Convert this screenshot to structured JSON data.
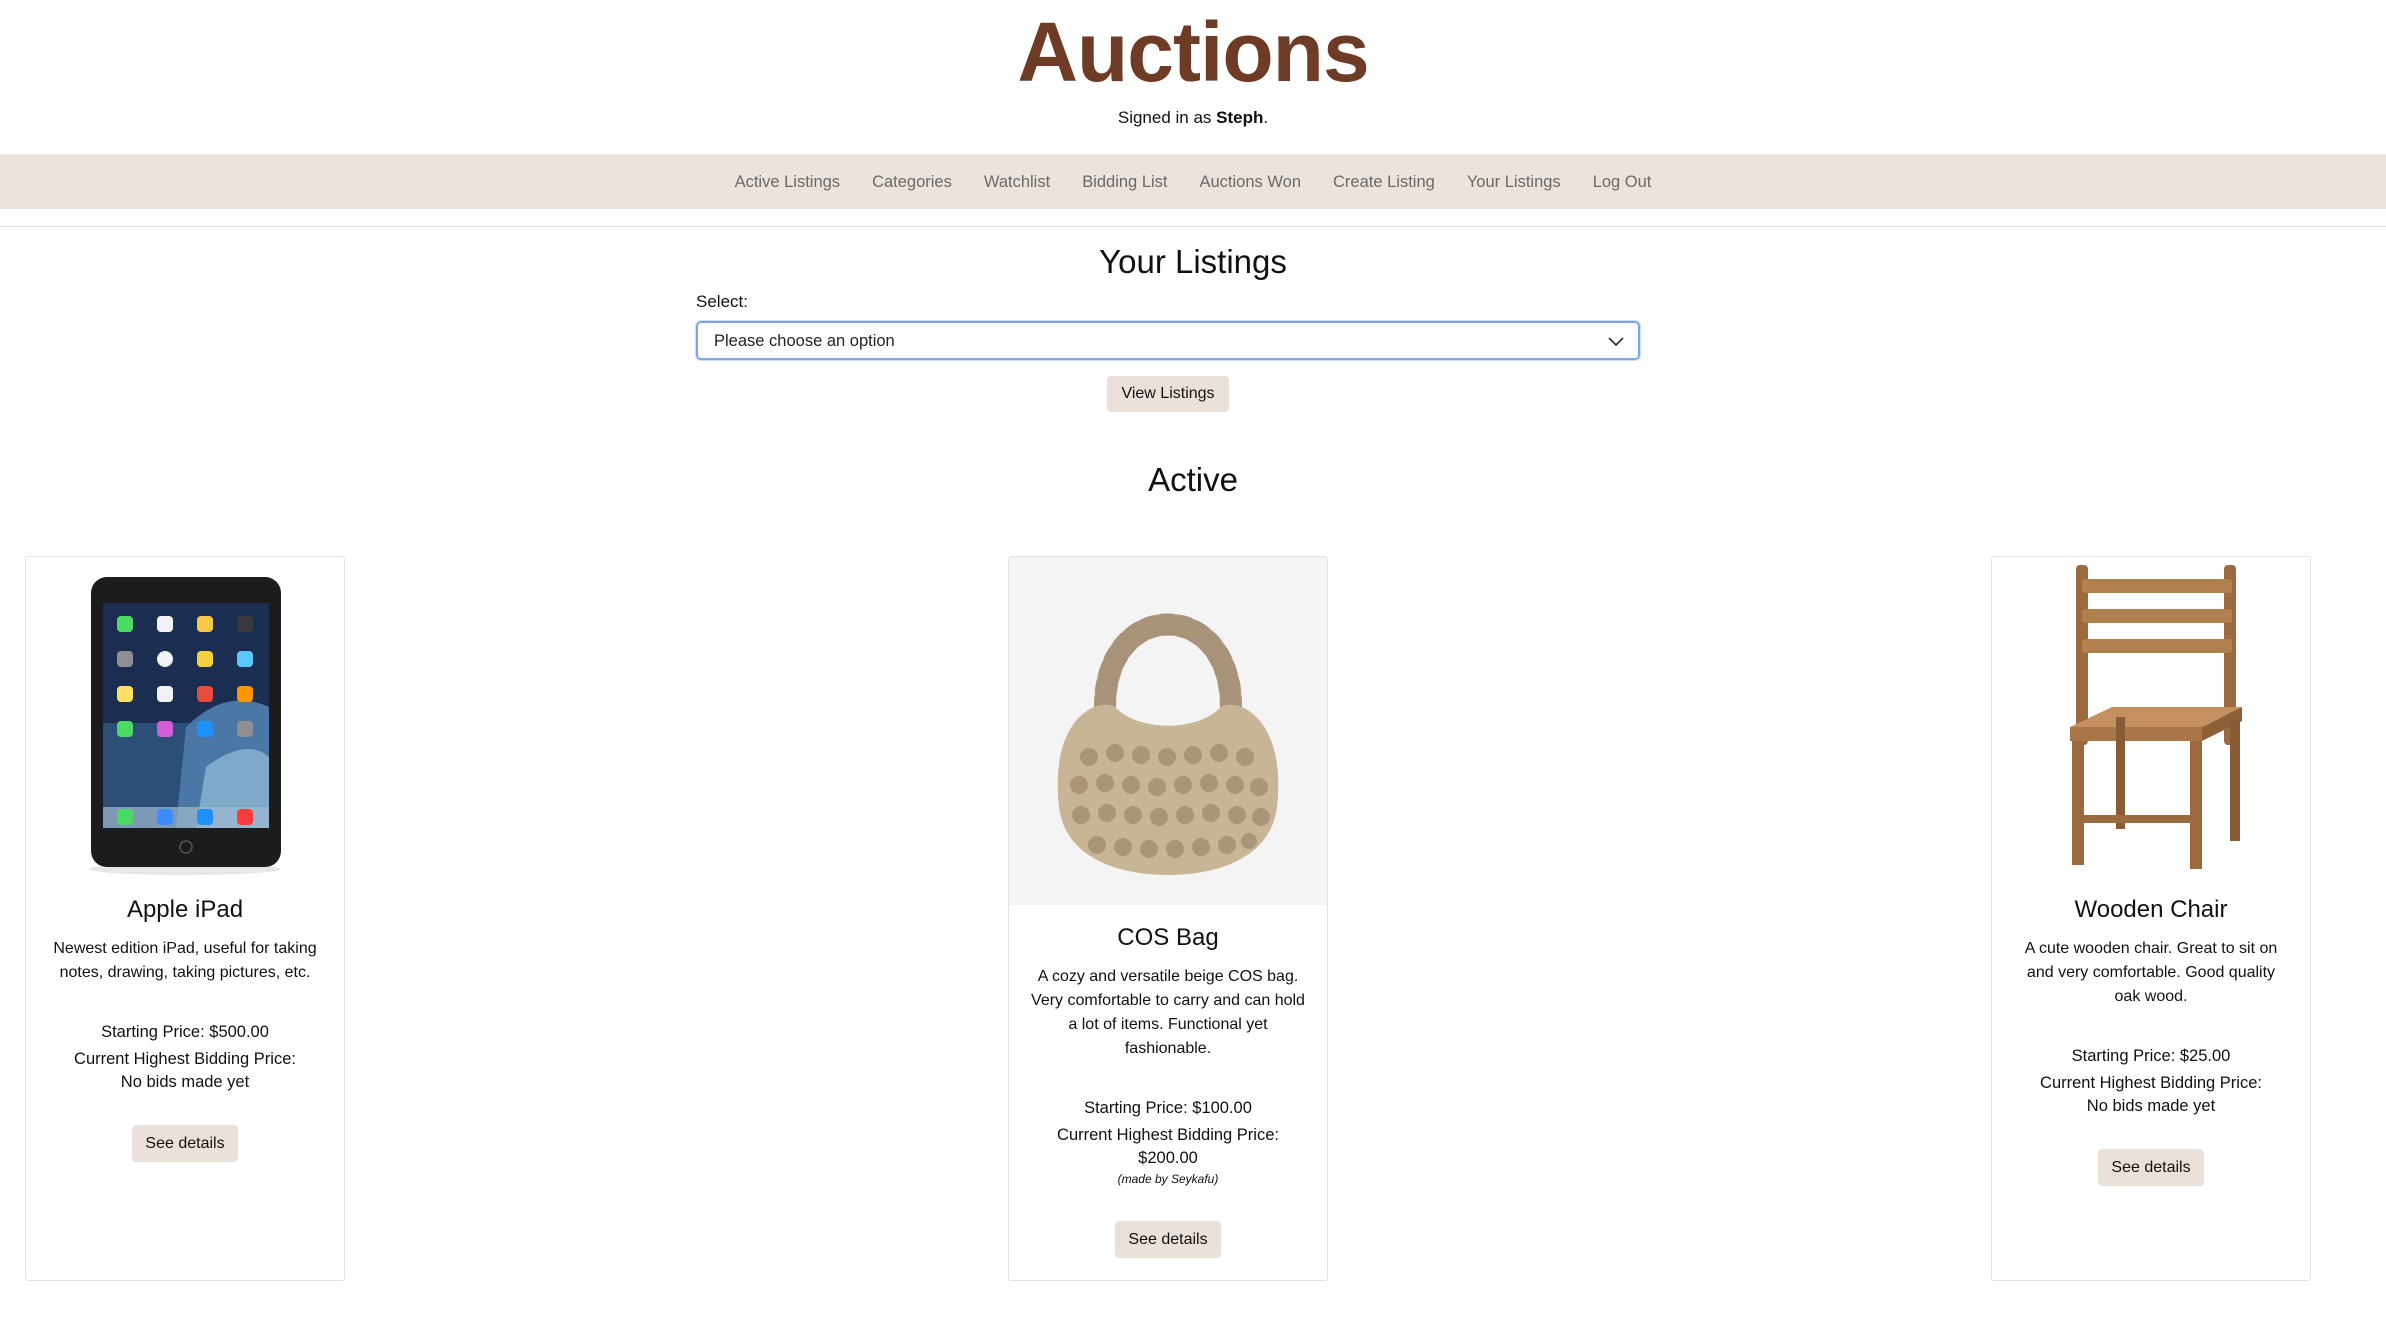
{
  "header": {
    "title": "Auctions",
    "signed_in_prefix": "Signed in as",
    "user": "Steph",
    "signed_in_suffix": "."
  },
  "nav": {
    "items": [
      "Active Listings",
      "Categories",
      "Watchlist",
      "Bidding List",
      "Auctions Won",
      "Create Listing",
      "Your Listings",
      "Log Out"
    ]
  },
  "main": {
    "heading": "Your Listings",
    "select_label": "Select:",
    "select_value": "Please choose an option",
    "view_button": "View Listings",
    "section_heading": "Active"
  },
  "listings": [
    {
      "title": "Apple iPad",
      "description": "Newest edition iPad, useful for taking notes, drawing, taking pictures, etc.",
      "starting_price": "Starting Price: $500.00",
      "bid_label": "Current Highest Bidding Price:",
      "bid_value": "No bids made yet",
      "bidder": "",
      "button": "See details"
    },
    {
      "title": "COS Bag",
      "description": "A cozy and versatile beige COS bag. Very comfortable to carry and can hold a lot of items. Functional yet fashionable.",
      "starting_price": "Starting Price: $100.00",
      "bid_label": "Current Highest Bidding Price:",
      "bid_value": "$200.00",
      "bidder": "(made by Seykafu)",
      "button": "See details"
    },
    {
      "title": "Wooden Chair",
      "description": "A cute wooden chair. Great to sit on and very comfortable. Good quality oak wood.",
      "starting_price": "Starting Price: $25.00",
      "bid_label": "Current Highest Bidding Price:",
      "bid_value": "No bids made yet",
      "bidder": "",
      "button": "See details"
    }
  ],
  "colors": {
    "title": "#6e3b24",
    "navbar": "#ebe3dc",
    "button": "#e9e1da",
    "select_border": "#7ea6e6"
  }
}
